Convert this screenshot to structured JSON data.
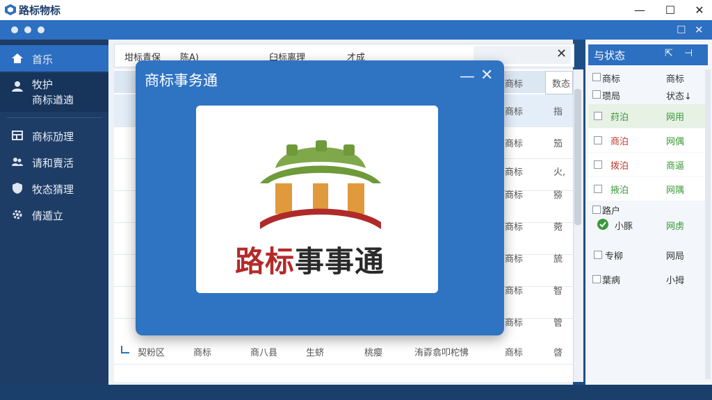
{
  "window": {
    "title": "路标物标",
    "min": "—",
    "max": "☐",
    "close": "✕"
  },
  "appbar": {
    "restore": "☐",
    "close": "✕"
  },
  "sidebar": {
    "items": [
      {
        "icon": "home-icon",
        "label": "首乐"
      },
      {
        "icon": "user-icon",
        "label": "牧护",
        "sub": "商标遒遖"
      },
      {
        "icon": "table-icon",
        "label": "商标劢理"
      },
      {
        "icon": "users-icon",
        "label": "请和賣活"
      },
      {
        "icon": "shield-icon",
        "label": "牧态猜理"
      },
      {
        "icon": "gear-icon",
        "label": "倩遁立"
      }
    ]
  },
  "toolbar": {
    "filter1": "坩标青保",
    "filter1_value": "陈A)",
    "filter2": "臼标离理",
    "filter2_value": "才成",
    "close": "✕"
  },
  "table": {
    "header_col_a": "商标",
    "header_col_b": "数态",
    "rows": [
      {
        "a": "商标",
        "b": "指"
      },
      {
        "a": "商标",
        "b": "笳"
      },
      {
        "a": "商标",
        "b": "火,"
      },
      {
        "a": "商标",
        "b": "猕"
      },
      {
        "a": "商标",
        "b": "菀"
      },
      {
        "a": "商标",
        "b": "旈"
      },
      {
        "a": "商标",
        "b": "智"
      },
      {
        "a": "商标",
        "b": "管"
      }
    ],
    "bottom_row": [
      "契粉区",
      "商标",
      "商八县",
      "生蛴",
      "桃瘿",
      "洧孬翕叩柁怫",
      "商标",
      "晵"
    ]
  },
  "right_panel": {
    "title": "与状态",
    "col1": "商标",
    "col2": "商标",
    "items": [
      {
        "name": "瓒局",
        "status": "状态↓",
        "color": "#333333"
      },
      {
        "name": "荮泊",
        "status": "网用",
        "color": "#3a9a3a"
      },
      {
        "name": "商泊",
        "status": "网偶",
        "color": "#c0392b"
      },
      {
        "name": "拨泊",
        "status": "商逼",
        "color": "#c0392b"
      },
      {
        "name": "掖泊",
        "status": "网隅",
        "color": "#3a9a3a"
      },
      {
        "name": "路户",
        "status": "",
        "color": "#333333"
      },
      {
        "name": "小豚",
        "status": "网虏",
        "color": "#333333"
      },
      {
        "name": "专柳",
        "status": "网局",
        "color": "#333333"
      },
      {
        "name": "葉病",
        "status": "小拇",
        "color": "#333333"
      }
    ]
  },
  "modal": {
    "title": "商标事务通",
    "min": "—",
    "close": "✕",
    "logo_text_red": "路标",
    "logo_text_dark": "事事通"
  }
}
